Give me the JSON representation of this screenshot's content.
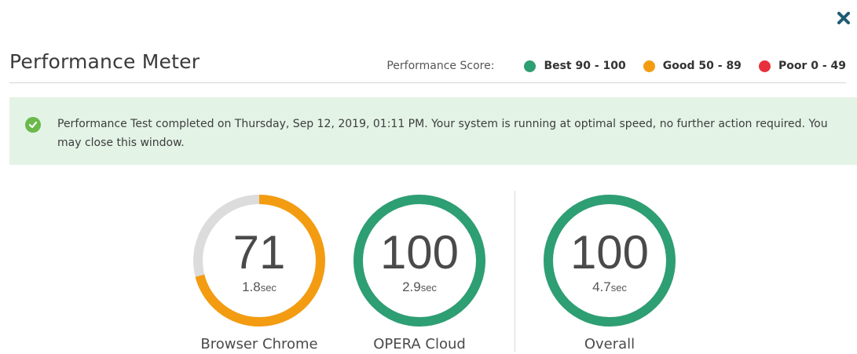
{
  "window": {
    "close_icon": "close-icon"
  },
  "header": {
    "title": "Performance Meter"
  },
  "legend": {
    "caption": "Performance Score:",
    "items": [
      {
        "label": "Best 90 - 100",
        "color": "#2e9e73"
      },
      {
        "label": "Good 50 - 89",
        "color": "#f39c12"
      },
      {
        "label": "Poor 0 - 49",
        "color": "#e8303c"
      }
    ]
  },
  "alert": {
    "icon": "check-circle-icon",
    "message": "Performance Test completed on Thursday, Sep 12, 2019, 01:11 PM. Your system is running at optimal speed, no further action required. You may close this window."
  },
  "gauges": [
    {
      "score": "71",
      "score_value": 71,
      "time": "1.8",
      "unit": "sec",
      "label": "Browser Chrome",
      "color": "#f39c12"
    },
    {
      "score": "100",
      "score_value": 100,
      "time": "2.9",
      "unit": "sec",
      "label": "OPERA Cloud",
      "color": "#2e9e73"
    },
    {
      "score": "100",
      "score_value": 100,
      "time": "4.7",
      "unit": "sec",
      "label": "Overall",
      "color": "#2e9e73"
    }
  ],
  "colors": {
    "track": "#dcdcdc",
    "alert_bg": "#e3f3e6",
    "success": "#6ab94a",
    "close": "#1e5c74"
  }
}
